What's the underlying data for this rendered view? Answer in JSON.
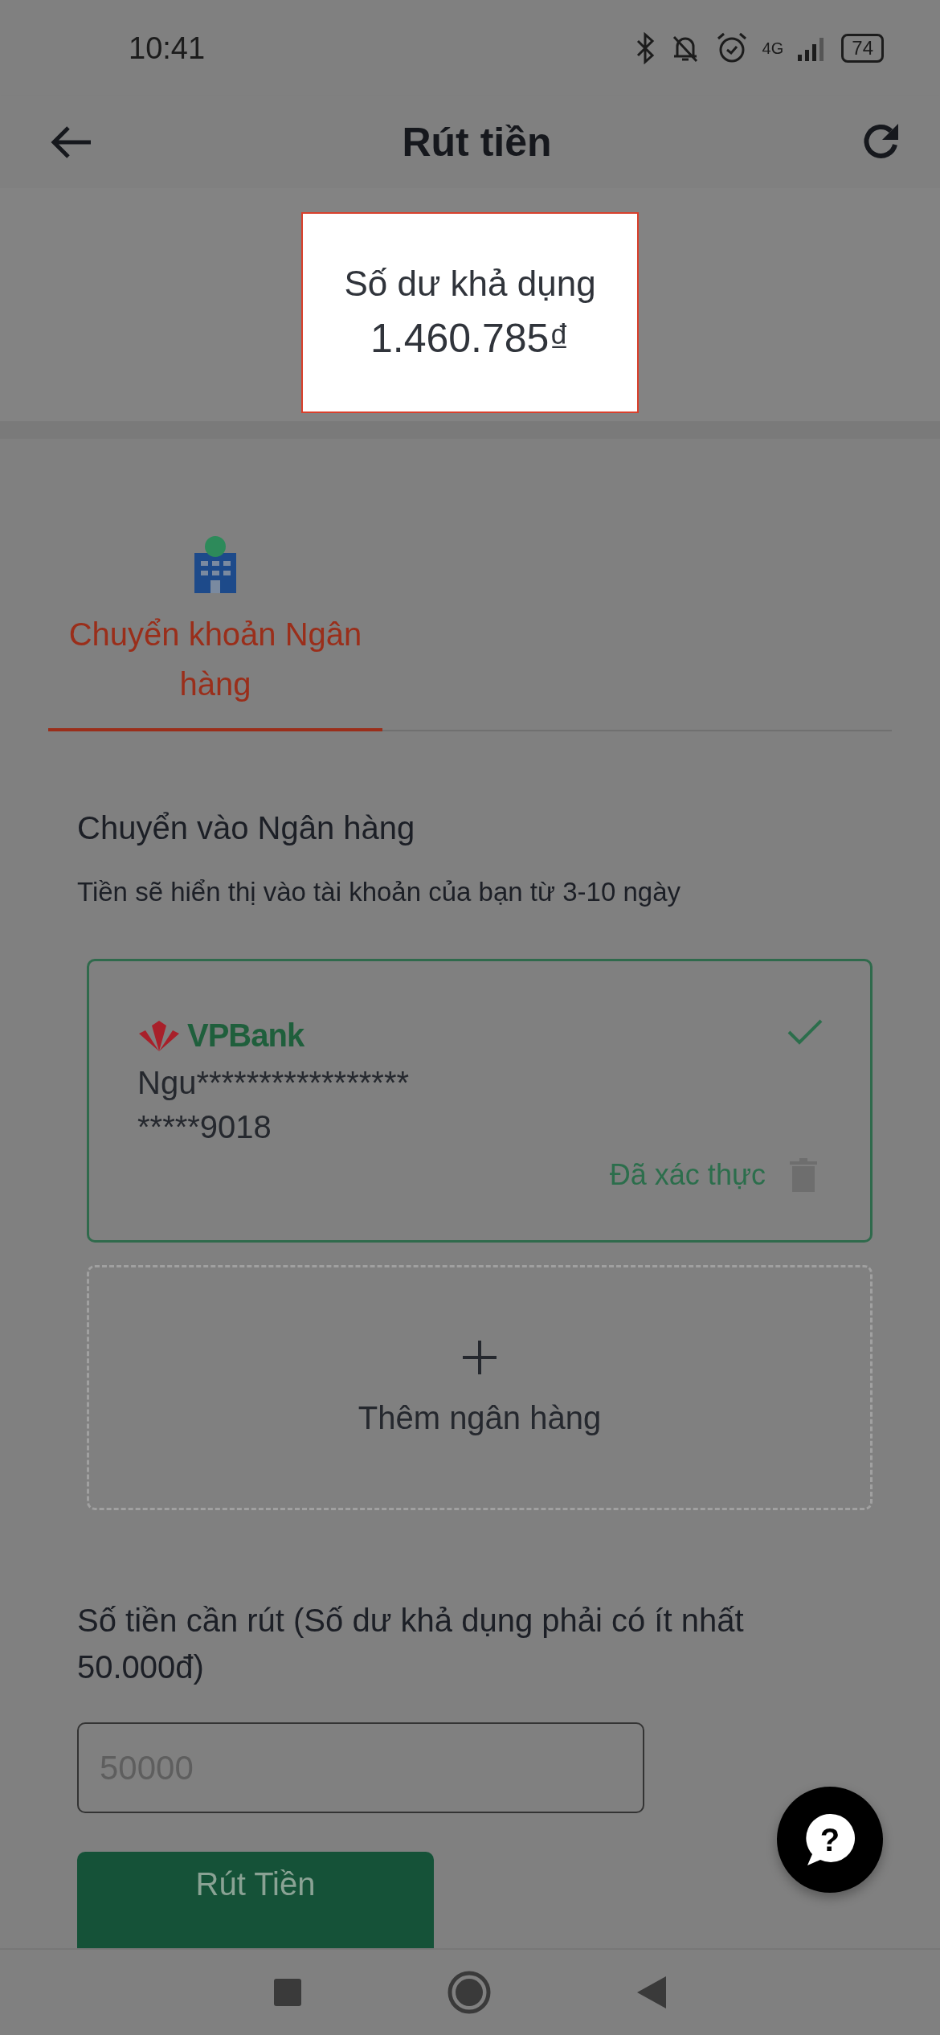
{
  "status_bar": {
    "time": "10:41",
    "network": "4G",
    "battery": "74"
  },
  "app_bar": {
    "title": "Rút tiền"
  },
  "balance": {
    "label": "Số dư khả dụng",
    "amount": "1.460.785₫"
  },
  "tabs": [
    {
      "label": "Chuyển khoản Ngân hàng",
      "selected": true
    }
  ],
  "section": {
    "title": "Chuyển vào Ngân hàng",
    "subtitle": "Tiền sẽ hiển thị vào tài khoản của bạn từ 3-10 ngày"
  },
  "bank_accounts": [
    {
      "bank": "VPBank",
      "holder": "Ngu*****************",
      "number": "*****9018",
      "status": "Đã xác thực",
      "selected": true
    }
  ],
  "add_bank": {
    "label": "Thêm ngân hàng"
  },
  "amount": {
    "label": "Số tiền cần rút (Số dư khả dụng phải có ít nhất 50.000đ)",
    "placeholder": "50000"
  },
  "submit": {
    "label": "Rút Tiền"
  },
  "help_button": {
    "icon": "?"
  }
}
